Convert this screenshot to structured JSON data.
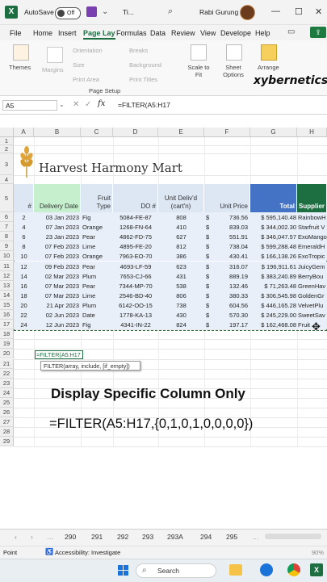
{
  "titlebar": {
    "autosave_label": "AutoSave",
    "autosave_state": "Off",
    "doc_title": "Ti...",
    "user_name": "Rabi Gurung"
  },
  "menu": [
    "File",
    "Home",
    "Insert",
    "Page Lay",
    "Formulas",
    "Data",
    "Review",
    "View",
    "Develope",
    "Help"
  ],
  "ribbon": {
    "themes_label": "Themes",
    "margins_label": "Margins",
    "orientation_label": "Orientation",
    "size_label": "Size",
    "print_area_label": "Print Area",
    "breaks_label": "Breaks",
    "background_label": "Background",
    "print_titles_label": "Print Titles",
    "scale_label": "Scale to Fit",
    "sheet_options_label": "Sheet Options",
    "arrange_label": "Arrange",
    "group_label": "Page Setup",
    "watermark": "xybernetics"
  },
  "formula_bar": {
    "name_box": "A5",
    "fx": "fx",
    "formula": "=FILTER(A5:H17"
  },
  "columns": [
    "A",
    "B",
    "C",
    "D",
    "E",
    "F",
    "G",
    "H"
  ],
  "rows": [
    "1",
    "2",
    "3",
    "4",
    "5",
    "6",
    "7",
    "8",
    "9",
    "10",
    "11",
    "12",
    "13",
    "14",
    "15",
    "16",
    "17",
    "18",
    "19",
    "20",
    "21",
    "22",
    "23",
    "24",
    "25",
    "26",
    "27",
    "28",
    "29"
  ],
  "company": "Harvest Harmony Mart",
  "table_headers": {
    "num": "#",
    "delivery": "Delivery Date",
    "fruit": "Fruit Type",
    "do": "DO #",
    "unit": "Unit Deliv'd (cart'n)",
    "price": "Unit Price",
    "total": "Total",
    "supplier": "Supplier"
  },
  "table_rows": [
    {
      "n": "2",
      "date": "03 Jan 2023",
      "fruit": "Fig",
      "do": "5084-FE-87",
      "units": "808",
      "cur": "$",
      "price": "736.56",
      "total": "$ 595,140.48",
      "sup": "RainbowH"
    },
    {
      "n": "4",
      "date": "07 Jan 2023",
      "fruit": "Orange",
      "do": "1268-FN-64",
      "units": "410",
      "cur": "$",
      "price": "839.03",
      "total": "$ 344,002.30",
      "sup": "Starfruit V"
    },
    {
      "n": "6",
      "date": "23 Jan 2023",
      "fruit": "Pear",
      "do": "4862-FD-75",
      "units": "627",
      "cur": "$",
      "price": "551.91",
      "total": "$ 346,047.57",
      "sup": "ExoMango"
    },
    {
      "n": "8",
      "date": "07 Feb 2023",
      "fruit": "Lime",
      "do": "4895-FE-20",
      "units": "812",
      "cur": "$",
      "price": "738.04",
      "total": "$ 599,288.48",
      "sup": "EmeraldH"
    },
    {
      "n": "10",
      "date": "07 Feb 2023",
      "fruit": "Orange",
      "do": "7963-EO-70",
      "units": "386",
      "cur": "$",
      "price": "430.41",
      "total": "$ 166,138.26",
      "sup": "ExoTropic"
    },
    {
      "n": "12",
      "date": "09 Feb 2023",
      "fruit": "Pear",
      "do": "4693-LF-59",
      "units": "623",
      "cur": "$",
      "price": "316.07",
      "total": "$ 196,911.61",
      "sup": "JuicyGem"
    },
    {
      "n": "14",
      "date": "02 Mar 2023",
      "fruit": "Plum",
      "do": "7653-CJ-66",
      "units": "431",
      "cur": "$",
      "price": "889.19",
      "total": "$ 383,240.89",
      "sup": "BerryBou"
    },
    {
      "n": "16",
      "date": "07 Mar 2023",
      "fruit": "Pear",
      "do": "7344-MP-70",
      "units": "538",
      "cur": "$",
      "price": "132.46",
      "total": "$  71,263.48",
      "sup": "GreenHav"
    },
    {
      "n": "18",
      "date": "07 Mar 2023",
      "fruit": "Lime",
      "do": "2546-BD-40",
      "units": "806",
      "cur": "$",
      "price": "380.33",
      "total": "$ 306,545.98",
      "sup": "GoldenGr"
    },
    {
      "n": "20",
      "date": "21 Apr 2023",
      "fruit": "Plum",
      "do": "6142-OO-15",
      "units": "738",
      "cur": "$",
      "price": "604.56",
      "total": "$ 446,165.28",
      "sup": "VelvetPlu"
    },
    {
      "n": "22",
      "date": "02 Jun 2023",
      "fruit": "Date",
      "do": "1778-KA-13",
      "units": "430",
      "cur": "$",
      "price": "570.30",
      "total": "$ 245,229.00",
      "sup": "SweetSav"
    },
    {
      "n": "24",
      "date": "12 Jun 2023",
      "fruit": "Fig",
      "do": "4341-IN-22",
      "units": "824",
      "cur": "$",
      "price": "197.17",
      "total": "$ 162,468.08",
      "sup": "Fruit"
    }
  ],
  "edit_cell": {
    "text": "=FILTER(A5:H17",
    "tooltip": "FILTER(array, include, [if_empty])"
  },
  "caption": {
    "line1": "Display Specific Column Only",
    "line2": "=FILTER(A5:H17,{0,1,0,1,0,0,0,0})"
  },
  "sheet_tabs": [
    "290",
    "291",
    "292",
    "293",
    "293A",
    "294",
    "295"
  ],
  "status": {
    "mode": "Point",
    "accessibility": "Accessibility: Investigate",
    "zoom": "90%"
  },
  "taskbar": {
    "search_placeholder": "Search"
  },
  "colors": {
    "excel_green": "#1d6f42",
    "table_header_blue": "#4472c4",
    "table_band": "#dde6f3",
    "delivery_green": "#c6efce"
  }
}
